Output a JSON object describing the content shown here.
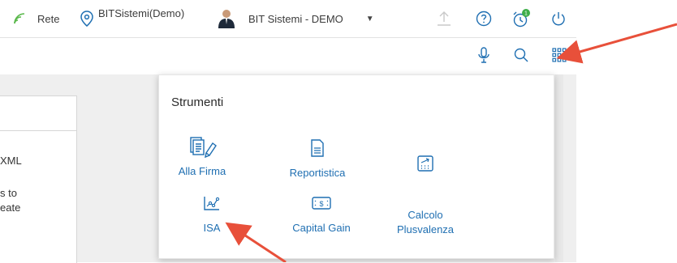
{
  "topbar": {
    "rete_label": "Rete",
    "location_label": "BITSistemi(Demo)",
    "user_label": "BIT Sistemi - DEMO",
    "notification_count": "1"
  },
  "left_panel": {
    "line1": "XML",
    "line2": "s to",
    "line3": "eate"
  },
  "tools_popup": {
    "title": "Strumenti",
    "items": [
      {
        "label": "Alla Firma",
        "icon": "documents-sign-icon"
      },
      {
        "label": "Reportistica",
        "icon": "document-icon"
      },
      {
        "label": "Calcolo\nPlusvalenza",
        "icon": "calculator-icon"
      },
      {
        "label": "ISA",
        "icon": "chart-line-icon"
      },
      {
        "label": "Capital Gain",
        "icon": "money-icon"
      }
    ]
  },
  "colors": {
    "accent_blue": "#1f6fb2",
    "wifi_green": "#59b84b",
    "arrow_red": "#e8503a"
  }
}
